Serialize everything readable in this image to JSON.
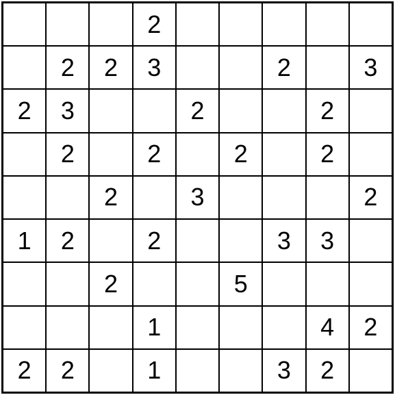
{
  "puzzle": {
    "type": "number-grid",
    "rows": 9,
    "cols": 9,
    "cells": [
      [
        "",
        "",
        "",
        "2",
        "",
        "",
        "",
        "",
        ""
      ],
      [
        "",
        "2",
        "2",
        "3",
        "",
        "",
        "2",
        "",
        "3"
      ],
      [
        "2",
        "3",
        "",
        "",
        "2",
        "",
        "",
        "2",
        ""
      ],
      [
        "",
        "2",
        "",
        "2",
        "",
        "2",
        "",
        "2",
        ""
      ],
      [
        "",
        "",
        "2",
        "",
        "3",
        "",
        "",
        "",
        "2"
      ],
      [
        "1",
        "2",
        "",
        "2",
        "",
        "",
        "3",
        "3",
        ""
      ],
      [
        "",
        "",
        "2",
        "",
        "",
        "5",
        "",
        "",
        ""
      ],
      [
        "",
        "",
        "",
        "1",
        "",
        "",
        "",
        "4",
        "2"
      ],
      [
        "2",
        "2",
        "",
        "1",
        "",
        "",
        "3",
        "2",
        ""
      ]
    ]
  }
}
